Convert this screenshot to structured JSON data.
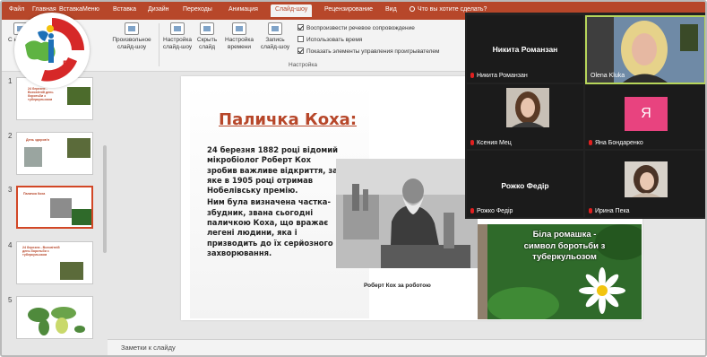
{
  "ribbon": {
    "tabs": [
      "Файл",
      "Главная",
      "Вставка",
      "Меню",
      "Вставка",
      "Дизайн",
      "Переходы",
      "Анимация",
      "Слайд-шоу",
      "Рецензирование",
      "Вид"
    ],
    "active_tab": "Слайд-шоу",
    "tell_me": "Что вы хотите сделать?",
    "buttons": {
      "start": "С начала",
      "custom_show": "Произвольное слайд-шоу",
      "setup": "Настройка слайд-шоу",
      "hide": "Скрыть слайд",
      "rehearse": "Настройка времени",
      "record": "Запись слайд-шоу"
    },
    "checkboxes": [
      {
        "label": "Воспроизвести речевое сопровождение",
        "checked": true
      },
      {
        "label": "Использовать время",
        "checked": false
      },
      {
        "label": "Показать элементы управления проигрывателем",
        "checked": true
      }
    ],
    "group_label": "Настройка"
  },
  "logo": {
    "text": "ГЗ",
    "colors": [
      "#d62828",
      "#1d70b7",
      "#5fb342",
      "#f4c20d"
    ]
  },
  "thumbnails": [
    {
      "number": "1",
      "title": "24 березня - Всесвітній день боротьби з туберкульозом"
    },
    {
      "number": "2",
      "title": "День здоров'я"
    },
    {
      "number": "3",
      "title": "Паличка Коха",
      "selected": true
    },
    {
      "number": "4",
      "title": "24 березня - Всесвітній день боротьби з туберкульозом"
    },
    {
      "number": "5",
      "title": ""
    }
  ],
  "slide": {
    "title": "Паличка Коха:",
    "paragraphs": [
      "24 березня 1882 році відомий мікробіолог Роберт Кох зробив важливе відкриття, за яке в 1905 році отримав Нобелівську премію.",
      "Ним була визначена частка-збудник, звана сьогодні паличкою Коха, що вражає легені людини, яка і призводить до їх серйозного захворювання."
    ],
    "photo_caption": "Роберт Кох за роботою",
    "daisy_lines": [
      "Біла ромашка -",
      "символ боротьби з",
      "туберкульозом"
    ]
  },
  "notes": {
    "placeholder": "Заметки к слайду"
  },
  "video_call": {
    "tiles": [
      {
        "display": "Никита Романзан",
        "name": "Никита Романзан",
        "type": "text"
      },
      {
        "display": "",
        "name": "Olena Kluka",
        "type": "camera",
        "speaker": true
      },
      {
        "display": "",
        "name": "Ксения Мец",
        "type": "camera"
      },
      {
        "display": "Я",
        "name": "Яна Бондаренко",
        "type": "initial",
        "color": "#e8437f"
      },
      {
        "display": "Рожко Федір",
        "name": "Рожко Федір",
        "type": "text"
      },
      {
        "display": "",
        "name": "Ирина Пека",
        "type": "camera"
      }
    ]
  }
}
